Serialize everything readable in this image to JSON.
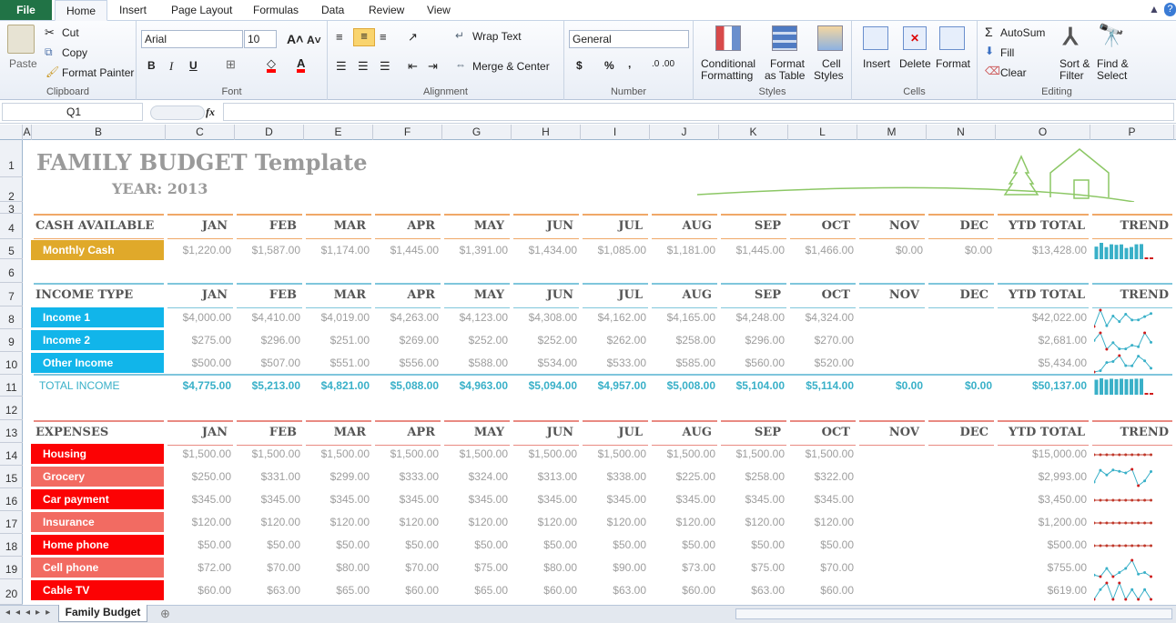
{
  "menu": {
    "file": "File",
    "tabs": [
      "Home",
      "Insert",
      "Page Layout",
      "Formulas",
      "Data",
      "Review",
      "View"
    ]
  },
  "clipboard": {
    "paste": "Paste",
    "cut": "Cut",
    "copy": "Copy",
    "format_painter": "Format Painter",
    "label": "Clipboard"
  },
  "font": {
    "name": "Arial",
    "size": "10",
    "label": "Font",
    "bold": "B",
    "italic": "I",
    "underline": "U"
  },
  "alignment": {
    "wrap_text": "Wrap Text",
    "merge_center": "Merge & Center",
    "label": "Alignment"
  },
  "number": {
    "format": "General",
    "currency": "$",
    "percent": "%",
    "comma": ",",
    "label": "Number"
  },
  "styles": {
    "conditional": "Conditional",
    "formatting": "Formatting",
    "format_as": "Format",
    "as_table": "as Table",
    "cell": "Cell",
    "cell_styles": "Styles",
    "label": "Styles"
  },
  "cells": {
    "insert": "Insert",
    "delete": "Delete",
    "format": "Format",
    "label": "Cells"
  },
  "editing": {
    "autosum": "AutoSum",
    "fill": "Fill",
    "clear": "Clear",
    "sort_filter": "Sort &",
    "filter": "Filter",
    "find_select": "Find &",
    "select": "Select",
    "label": "Editing"
  },
  "formula_bar": {
    "name_box": "Q1",
    "fx": "fx",
    "content": ""
  },
  "columns": [
    "A",
    "B",
    "C",
    "D",
    "E",
    "F",
    "G",
    "H",
    "I",
    "J",
    "K",
    "L",
    "M",
    "N",
    "O",
    "P"
  ],
  "rows": [
    "1",
    "2",
    "3",
    "4",
    "5",
    "6",
    "7",
    "8",
    "9",
    "10",
    "11",
    "12",
    "13",
    "14",
    "15",
    "16",
    "17",
    "18",
    "19",
    "20"
  ],
  "sheet": {
    "title": "FAMILY BUDGET Template",
    "year": "YEAR: 2013",
    "months": [
      "JAN",
      "FEB",
      "MAR",
      "APR",
      "MAY",
      "JUN",
      "JUL",
      "AUG",
      "SEP",
      "OCT",
      "NOV",
      "DEC"
    ],
    "ytd_total": "YTD TOTAL",
    "trend": "TREND",
    "cash": {
      "header": "CASH AVAILABLE",
      "rows": [
        {
          "label": "Monthly Cash",
          "values": [
            "$1,220.00",
            "$1,587.00",
            "$1,174.00",
            "$1,445.00",
            "$1,391.00",
            "$1,434.00",
            "$1,085.00",
            "$1,181.00",
            "$1,445.00",
            "$1,466.00",
            "$0.00",
            "$0.00"
          ],
          "ytd": "$13,428.00"
        }
      ]
    },
    "income": {
      "header": "INCOME TYPE",
      "rows": [
        {
          "label": "Income 1",
          "values": [
            "$4,000.00",
            "$4,410.00",
            "$4,019.00",
            "$4,263.00",
            "$4,123.00",
            "$4,308.00",
            "$4,162.00",
            "$4,165.00",
            "$4,248.00",
            "$4,324.00",
            "",
            ""
          ],
          "ytd": "$42,022.00"
        },
        {
          "label": "Income 2",
          "values": [
            "$275.00",
            "$296.00",
            "$251.00",
            "$269.00",
            "$252.00",
            "$252.00",
            "$262.00",
            "$258.00",
            "$296.00",
            "$270.00",
            "",
            ""
          ],
          "ytd": "$2,681.00"
        },
        {
          "label": "Other Income",
          "values": [
            "$500.00",
            "$507.00",
            "$551.00",
            "$556.00",
            "$588.00",
            "$534.00",
            "$533.00",
            "$585.00",
            "$560.00",
            "$520.00",
            "",
            ""
          ],
          "ytd": "$5,434.00"
        }
      ],
      "total": {
        "label": "TOTAL INCOME",
        "values": [
          "$4,775.00",
          "$5,213.00",
          "$4,821.00",
          "$5,088.00",
          "$4,963.00",
          "$5,094.00",
          "$4,957.00",
          "$5,008.00",
          "$5,104.00",
          "$5,114.00",
          "$0.00",
          "$0.00"
        ],
        "ytd": "$50,137.00"
      }
    },
    "expenses": {
      "header": "EXPENSES",
      "rows": [
        {
          "label": "Housing",
          "values": [
            "$1,500.00",
            "$1,500.00",
            "$1,500.00",
            "$1,500.00",
            "$1,500.00",
            "$1,500.00",
            "$1,500.00",
            "$1,500.00",
            "$1,500.00",
            "$1,500.00",
            "",
            ""
          ],
          "ytd": "$15,000.00"
        },
        {
          "label": "Grocery",
          "values": [
            "$250.00",
            "$331.00",
            "$299.00",
            "$333.00",
            "$324.00",
            "$313.00",
            "$338.00",
            "$225.00",
            "$258.00",
            "$322.00",
            "",
            ""
          ],
          "ytd": "$2,993.00"
        },
        {
          "label": "Car payment",
          "values": [
            "$345.00",
            "$345.00",
            "$345.00",
            "$345.00",
            "$345.00",
            "$345.00",
            "$345.00",
            "$345.00",
            "$345.00",
            "$345.00",
            "",
            ""
          ],
          "ytd": "$3,450.00"
        },
        {
          "label": "Insurance",
          "values": [
            "$120.00",
            "$120.00",
            "$120.00",
            "$120.00",
            "$120.00",
            "$120.00",
            "$120.00",
            "$120.00",
            "$120.00",
            "$120.00",
            "",
            ""
          ],
          "ytd": "$1,200.00"
        },
        {
          "label": "Home phone",
          "values": [
            "$50.00",
            "$50.00",
            "$50.00",
            "$50.00",
            "$50.00",
            "$50.00",
            "$50.00",
            "$50.00",
            "$50.00",
            "$50.00",
            "",
            ""
          ],
          "ytd": "$500.00"
        },
        {
          "label": "Cell phone",
          "values": [
            "$72.00",
            "$70.00",
            "$80.00",
            "$70.00",
            "$75.00",
            "$80.00",
            "$90.00",
            "$73.00",
            "$75.00",
            "$70.00",
            "",
            ""
          ],
          "ytd": "$755.00"
        },
        {
          "label": "Cable TV",
          "values": [
            "$60.00",
            "$63.00",
            "$65.00",
            "$60.00",
            "$65.00",
            "$60.00",
            "$63.00",
            "$60.00",
            "$63.00",
            "$60.00",
            "",
            ""
          ],
          "ytd": "$619.00"
        }
      ]
    }
  },
  "sheet_tab": "Family Budget",
  "colors": {
    "cash": "#e0a92a",
    "income": "#11b5ea",
    "expense_dark": "#fc0204",
    "expense_light": "#f26b62",
    "teal": "#39b0c8",
    "orange_line": "#f0a868",
    "blue_line": "#7fc6dc",
    "red_line": "#e98a82",
    "green_art": "#8cc765"
  }
}
